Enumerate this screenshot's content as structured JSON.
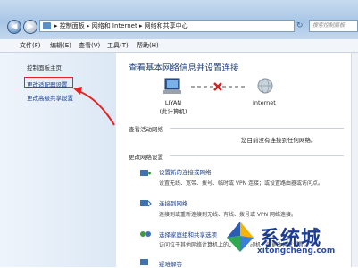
{
  "window": {
    "back_glyph": "◀",
    "forward_glyph": "▶",
    "address_path": "▸ 控制面板 ▸ 网络和 Internet ▸ 网络和共享中心",
    "refresh_glyph": "↻",
    "search_placeholder": "搜索控制面板"
  },
  "menu": [
    "文件(F)",
    "编辑(E)",
    "查看(V)",
    "工具(T)",
    "帮助(H)"
  ],
  "sidebar": {
    "home": "控制面板主页",
    "links": [
      "更改适配器设置",
      "更改高级共享设置"
    ]
  },
  "main": {
    "title": "查看基本网络信息并设置连接",
    "computer_name": "LIYAN",
    "computer_sub": "(此计算机)",
    "internet_label": "Internet",
    "active_header": "查看活动网络",
    "not_connected": "您目前没有连接到任何网络。",
    "change_header": "更改网络设置",
    "tasks": [
      {
        "title": "设置新的连接或网络",
        "desc": "设置无线、宽带、拨号、临时或 VPN 连接；或设置路由器或访问点。"
      },
      {
        "title": "连接到网络",
        "desc": "连接到或重新连接到无线、有线、拨号或 VPN 网络连接。"
      },
      {
        "title": "选择家庭组和共享选项",
        "desc": "访问位于其他网络计算机上的文件和打印机，或更改共享设置。"
      },
      {
        "title": "疑难解答",
        "desc": ""
      }
    ]
  },
  "watermark": {
    "text": "系统城",
    "url": "xitongcheng.com"
  },
  "colors": {
    "link": "#1a3e8c",
    "highlight": "#e32222",
    "title": "#1d3f7a"
  }
}
